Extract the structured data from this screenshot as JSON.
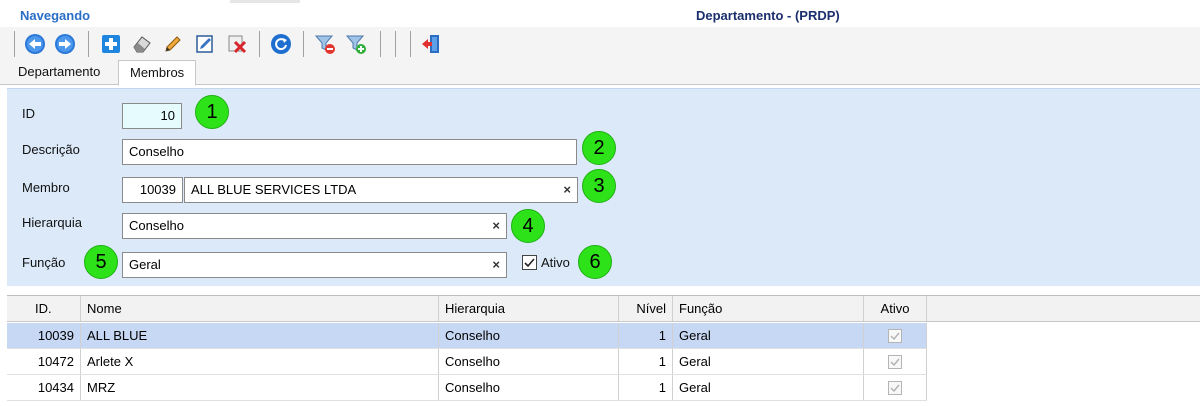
{
  "header": {
    "status": "Navegando",
    "title": "Departamento - (PRDP)"
  },
  "toolbar": {
    "buttons": [
      {
        "name": "prev-record-button",
        "icon": "arrow-left-icon"
      },
      {
        "name": "next-record-button",
        "icon": "arrow-right-icon"
      },
      {
        "name": "new-record-button",
        "icon": "plus-icon"
      },
      {
        "name": "clear-record-button",
        "icon": "eraser-icon"
      },
      {
        "name": "edit-record-button",
        "icon": "pencil-icon"
      },
      {
        "name": "save-record-button",
        "icon": "document-edit-icon"
      },
      {
        "name": "delete-record-button",
        "icon": "delete-x-icon"
      },
      {
        "name": "refresh-button",
        "icon": "refresh-icon"
      },
      {
        "name": "filter-remove-button",
        "icon": "filter-minus-icon"
      },
      {
        "name": "filter-add-button",
        "icon": "filter-plus-icon"
      },
      {
        "name": "exit-button",
        "icon": "exit-door-icon"
      }
    ]
  },
  "tabs": [
    {
      "label": "Departamento",
      "active": false
    },
    {
      "label": "Membros",
      "active": true
    }
  ],
  "form": {
    "id": {
      "label": "ID",
      "value": "10"
    },
    "descricao": {
      "label": "Descrição",
      "value": "Conselho"
    },
    "membro": {
      "label": "Membro",
      "code": "10039",
      "value": "ALL BLUE SERVICES LTDA"
    },
    "hierarquia": {
      "label": "Hierarquia",
      "value": "Conselho"
    },
    "funcao": {
      "label": "Função",
      "value": "Geral"
    },
    "ativo": {
      "label": "Ativo",
      "checked": true
    },
    "clear_glyph": "×"
  },
  "annotations": [
    "1",
    "2",
    "3",
    "4",
    "5",
    "6"
  ],
  "grid": {
    "columns": [
      "ID.",
      "Nome",
      "Hierarquia",
      "Nível",
      "Função",
      "Ativo"
    ],
    "rows": [
      {
        "id": "10039",
        "nome": "ALL BLUE",
        "hierarquia": "Conselho",
        "nivel": "1",
        "funcao": "Geral",
        "ativo": true,
        "selected": true
      },
      {
        "id": "10472",
        "nome": "Arlete X",
        "hierarquia": "Conselho",
        "nivel": "1",
        "funcao": "Geral",
        "ativo": true,
        "selected": false
      },
      {
        "id": "10434",
        "nome": "MRZ",
        "hierarquia": "Conselho",
        "nivel": "1",
        "funcao": "Geral",
        "ativo": true,
        "selected": false
      }
    ]
  },
  "colors": {
    "accent": "#2a6ec6",
    "title": "#1b2f6e",
    "panel": "#dbe9f9",
    "badge": "#2ee21a",
    "selected_row": "#c7d8f4"
  }
}
